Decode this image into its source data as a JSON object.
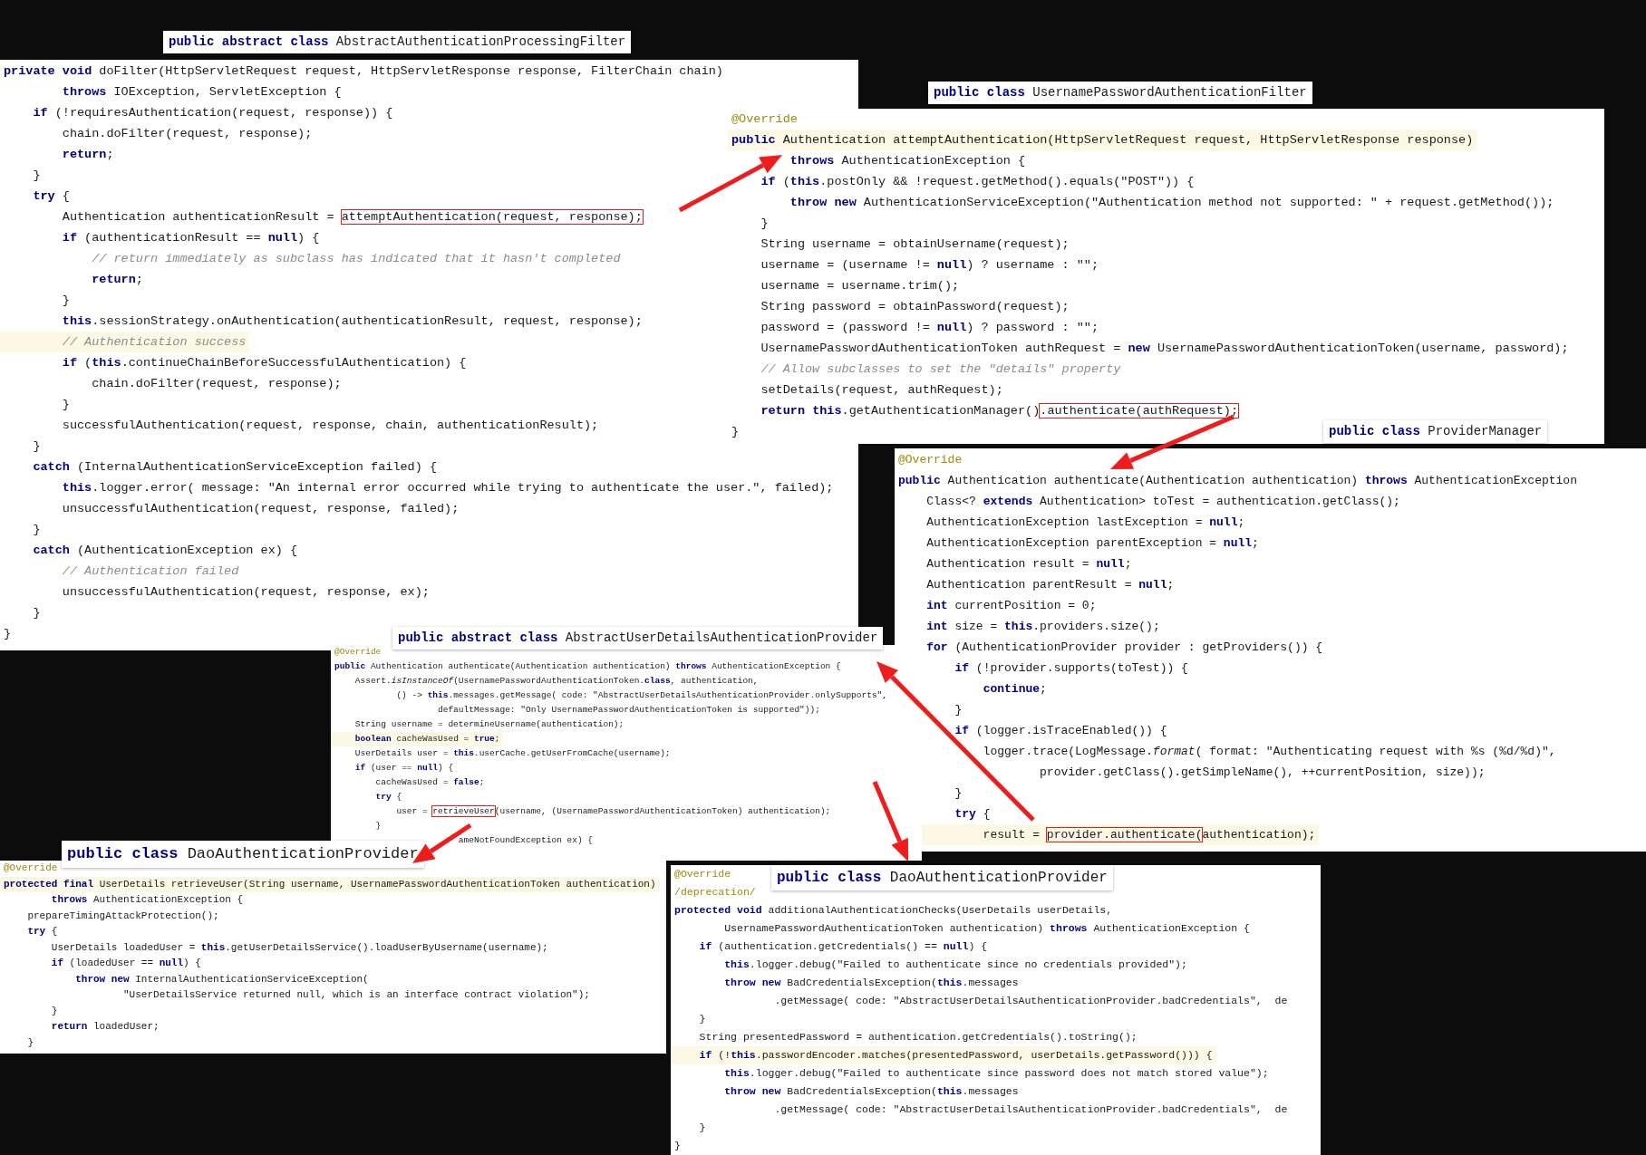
{
  "panels": [
    {
      "title": "**public** **abstract** **class** AbstractAuthenticationProcessingFilter",
      "lines": [
        {
          "kind": "code",
          "current": false,
          "text": "**private** **void** doFilter(HttpServletRequest request, HttpServletResponse response, FilterChain chain)"
        },
        {
          "kind": "code",
          "current": false,
          "text": "        **throws** IOException, ServletException {"
        },
        {
          "kind": "code",
          "current": false,
          "text": "    **if** (!requiresAuthentication(request, response)) {"
        },
        {
          "kind": "code",
          "current": false,
          "text": "        chain.doFilter(request, response);"
        },
        {
          "kind": "code",
          "current": false,
          "text": "        **return**;"
        },
        {
          "kind": "code",
          "current": false,
          "text": "    }"
        },
        {
          "kind": "code",
          "current": false,
          "text": "    **try** {"
        },
        {
          "kind": "code",
          "current": false,
          "text": "        Authentication authenticationResult = ",
          "boxed": "attemptAuthentication(request, response);"
        },
        {
          "kind": "code",
          "current": false,
          "text": "        **if** (authenticationResult == **null**) {"
        },
        {
          "kind": "comment",
          "current": false,
          "text": "            // return immediately as subclass has indicated that it hasn't completed"
        },
        {
          "kind": "code",
          "current": false,
          "text": "            **return**;"
        },
        {
          "kind": "code",
          "current": false,
          "text": "        }"
        },
        {
          "kind": "code",
          "current": false,
          "text": "        **this**.sessionStrategy.onAuthentication(authenticationResult, request, response);"
        },
        {
          "kind": "comment",
          "current": true,
          "text": "        // Authentication success"
        },
        {
          "kind": "code",
          "current": false,
          "text": "        **if** (**this**.continueChainBeforeSuccessfulAuthentication) {"
        },
        {
          "kind": "code",
          "current": false,
          "text": "            chain.doFilter(request, response);"
        },
        {
          "kind": "code",
          "current": false,
          "text": "        }"
        },
        {
          "kind": "code",
          "current": false,
          "text": "        successfulAuthentication(request, response, chain, authenticationResult);"
        },
        {
          "kind": "code",
          "current": false,
          "text": "    }"
        },
        {
          "kind": "code",
          "current": false,
          "text": "    **catch** (InternalAuthenticationServiceException failed) {"
        },
        {
          "kind": "code",
          "current": false,
          "text": "        **this**.logger.error( message: \"An internal error occurred while trying to authenticate the user.\", failed);"
        },
        {
          "kind": "code",
          "current": false,
          "text": "        unsuccessfulAuthentication(request, response, failed);"
        },
        {
          "kind": "code",
          "current": false,
          "text": "    }"
        },
        {
          "kind": "code",
          "current": false,
          "text": "    **catch** (AuthenticationException ex) {"
        },
        {
          "kind": "comment",
          "current": false,
          "text": "        // Authentication failed"
        },
        {
          "kind": "code",
          "current": false,
          "text": "        unsuccessfulAuthentication(request, response, ex);"
        },
        {
          "kind": "code",
          "current": false,
          "text": "    }"
        },
        {
          "kind": "code",
          "current": false,
          "text": "}"
        }
      ]
    },
    {
      "title": "**public** **class** UsernamePasswordAuthenticationFilter",
      "lines": [
        {
          "kind": "annotation",
          "current": false,
          "text": "@Override"
        },
        {
          "kind": "code",
          "current": true,
          "text": "**public** Authentication attemptAuthentication(HttpServletRequest request, HttpServletResponse response)"
        },
        {
          "kind": "code",
          "current": false,
          "text": "        **throws** AuthenticationException {"
        },
        {
          "kind": "code",
          "current": false,
          "text": "    **if** (**this**.postOnly && !request.getMethod().equals(\"POST\")) {"
        },
        {
          "kind": "code",
          "current": false,
          "text": "        **throw** **new** AuthenticationServiceException(\"Authentication method not supported: \" + request.getMethod());"
        },
        {
          "kind": "code",
          "current": false,
          "text": "    }"
        },
        {
          "kind": "code",
          "current": false,
          "text": "    String username = obtainUsername(request);"
        },
        {
          "kind": "code",
          "current": false,
          "text": "    username = (username != **null**) ? username : \"\";"
        },
        {
          "kind": "code",
          "current": false,
          "text": "    username = username.trim();"
        },
        {
          "kind": "code",
          "current": false,
          "text": "    String password = obtainPassword(request);"
        },
        {
          "kind": "code",
          "current": false,
          "text": "    password = (password != **null**) ? password : \"\";"
        },
        {
          "kind": "code",
          "current": false,
          "text": "    UsernamePasswordAuthenticationToken authRequest = **new** UsernamePasswordAuthenticationToken(username, password);"
        },
        {
          "kind": "comment",
          "current": false,
          "text": "    // Allow subclasses to set the \"details\" property"
        },
        {
          "kind": "code",
          "current": false,
          "text": "    setDetails(request, authRequest);"
        },
        {
          "kind": "code",
          "current": false,
          "text": "    **return** **this**.getAuthenticationManager()",
          "boxed": ".authenticate(authRequest);"
        },
        {
          "kind": "code",
          "current": false,
          "text": "}"
        }
      ]
    },
    {
      "title": "**public** **abstract** **class** AbstractUserDetailsAuthenticationProvider",
      "lines": [
        {
          "kind": "annotation",
          "current": false,
          "text": "@Override"
        },
        {
          "kind": "code",
          "current": false,
          "text": "**public** Authentication authenticate(Authentication authentication) **throws** AuthenticationException {"
        },
        {
          "kind": "code",
          "current": false,
          "text": "    Assert.*isInstanceOf*(UsernamePasswordAuthenticationToken.**class**, authentication,"
        },
        {
          "kind": "code",
          "current": false,
          "text": "            () -> **this**.messages.getMessage( code: \"AbstractUserDetailsAuthenticationProvider.onlySupports\","
        },
        {
          "kind": "code",
          "current": false,
          "text": "                    defaultMessage: \"Only UsernamePasswordAuthenticationToken is supported\"));"
        },
        {
          "kind": "code",
          "current": false,
          "text": "    String username = determineUsername(authentication);"
        },
        {
          "kind": "code",
          "current": true,
          "text": "    **boolean** cacheWasUsed = **true**;"
        },
        {
          "kind": "code",
          "current": false,
          "text": "    UserDetails user = **this**.userCache.getUserFromCache(username);"
        },
        {
          "kind": "code",
          "current": false,
          "text": "    **if** (user == **null**) {"
        },
        {
          "kind": "code",
          "current": false,
          "text": "        cacheWasUsed = **false**;"
        },
        {
          "kind": "code",
          "current": false,
          "text": "        **try** {"
        },
        {
          "kind": "code",
          "current": false,
          "text": "            user = ",
          "boxed": "retrieveUser",
          "after": "(username, (UsernamePasswordAuthenticationToken) authentication);"
        },
        {
          "kind": "code",
          "current": false,
          "text": "        }"
        },
        {
          "kind": "code",
          "current": false,
          "text": "                        ameNotFoundException ex) {"
        }
      ]
    },
    {
      "title": "**public** **class** ProviderManager",
      "lines": [
        {
          "kind": "annotation",
          "current": false,
          "text": "@Override"
        },
        {
          "kind": "code",
          "current": false,
          "text": "**public** Authentication authenticate(Authentication authentication) **throws** AuthenticationException"
        },
        {
          "kind": "code",
          "current": false,
          "text": "    Class<? **extends** Authentication> toTest = authentication.getClass();"
        },
        {
          "kind": "code",
          "current": false,
          "text": "    AuthenticationException lastException = **null**;"
        },
        {
          "kind": "code",
          "current": false,
          "text": "    AuthenticationException parentException = **null**;"
        },
        {
          "kind": "code",
          "current": false,
          "text": "    Authentication result = **null**;"
        },
        {
          "kind": "code",
          "current": false,
          "text": "    Authentication parentResult = **null**;"
        },
        {
          "kind": "code",
          "current": false,
          "text": "    **int** currentPosition = 0;"
        },
        {
          "kind": "code",
          "current": false,
          "text": "    **int** size = **this**.providers.size();"
        },
        {
          "kind": "code",
          "current": false,
          "text": "    **for** (AuthenticationProvider provider : getProviders()) {"
        },
        {
          "kind": "code",
          "current": false,
          "text": "        **if** (!provider.supports(toTest)) {"
        },
        {
          "kind": "code",
          "current": false,
          "text": "            **continue**;"
        },
        {
          "kind": "code",
          "current": false,
          "text": "        }"
        },
        {
          "kind": "code",
          "current": false,
          "text": "        **if** (logger.isTraceEnabled()) {"
        },
        {
          "kind": "code",
          "current": false,
          "text": "            logger.trace(LogMessage.*format*( format: \"Authenticating request with %s (%d/%d)\","
        },
        {
          "kind": "code",
          "current": false,
          "text": "                    provider.getClass().getSimpleName(), ++currentPosition, size));"
        },
        {
          "kind": "code",
          "current": false,
          "text": "        }"
        },
        {
          "kind": "code",
          "current": false,
          "text": "        **try** {"
        },
        {
          "kind": "code",
          "current": true,
          "text": "            result = ",
          "boxed": "provider.authenticate(",
          "after": "authentication);"
        }
      ]
    },
    {
      "title": "**public** **class** DaoAuthenticationProvider",
      "lines": [
        {
          "kind": "annotation",
          "current": false,
          "text": "@Override"
        },
        {
          "kind": "code",
          "current": true,
          "text": "**protected** **final** UserDetails retrieveUser(String username, UsernamePasswordAuthenticationToken authentication)"
        },
        {
          "kind": "code",
          "current": false,
          "text": "        **throws** AuthenticationException {"
        },
        {
          "kind": "code",
          "current": false,
          "text": "    prepareTimingAttackProtection();"
        },
        {
          "kind": "code",
          "current": false,
          "text": "    **try** {"
        },
        {
          "kind": "code",
          "current": false,
          "text": "        UserDetails loadedUser = **this**.getUserDetailsService().loadUserByUsername(username);"
        },
        {
          "kind": "code",
          "current": false,
          "text": "        **if** (loadedUser == **null**) {"
        },
        {
          "kind": "code",
          "current": false,
          "text": "            **throw** **new** InternalAuthenticationServiceException("
        },
        {
          "kind": "code",
          "current": false,
          "text": "                    \"UserDetailsService returned null, which is an interface contract violation\");"
        },
        {
          "kind": "code",
          "current": false,
          "text": "        }"
        },
        {
          "kind": "code",
          "current": false,
          "text": "        **return** loadedUser;"
        },
        {
          "kind": "code",
          "current": false,
          "text": "    }"
        }
      ]
    },
    {
      "title": "**public** **class** DaoAuthenticationProvider",
      "lines": [
        {
          "kind": "annotation",
          "current": false,
          "text": "@Override"
        },
        {
          "kind": "annotation",
          "current": false,
          "text": "/deprecation/"
        },
        {
          "kind": "code",
          "current": false,
          "text": "**protected** **void** additionalAuthenticationChecks(UserDetails userDetails,"
        },
        {
          "kind": "code",
          "current": false,
          "text": "        UsernamePasswordAuthenticationToken authentication) **throws** AuthenticationException {"
        },
        {
          "kind": "code",
          "current": false,
          "text": "    **if** (authentication.getCredentials() == **null**) {"
        },
        {
          "kind": "code",
          "current": false,
          "text": "        **this**.logger.debug(\"Failed to authenticate since no credentials provided\");"
        },
        {
          "kind": "code",
          "current": false,
          "text": "        **throw** **new** BadCredentialsException(**this**.messages"
        },
        {
          "kind": "code",
          "current": false,
          "text": "                .getMessage( code: \"AbstractUserDetailsAuthenticationProvider.badCredentials\",  de"
        },
        {
          "kind": "code",
          "current": false,
          "text": "    }"
        },
        {
          "kind": "code",
          "current": false,
          "text": "    String presentedPassword = authentication.getCredentials().toString();"
        },
        {
          "kind": "code",
          "current": true,
          "text": "    **if** (!**this**.passwordEncoder.matches(presentedPassword, userDetails.getPassword())) {"
        },
        {
          "kind": "code",
          "current": false,
          "text": "        **this**.logger.debug(\"Failed to authenticate since password does not match stored value\");"
        },
        {
          "kind": "code",
          "current": false,
          "text": "        **throw** **new** BadCredentialsException(**this**.messages"
        },
        {
          "kind": "code",
          "current": false,
          "text": "                .getMessage( code: \"AbstractUserDetailsAuthenticationProvider.badCredentials\",  de"
        },
        {
          "kind": "code",
          "current": false,
          "text": "    }"
        },
        {
          "kind": "code",
          "current": false,
          "text": "}"
        }
      ]
    }
  ]
}
